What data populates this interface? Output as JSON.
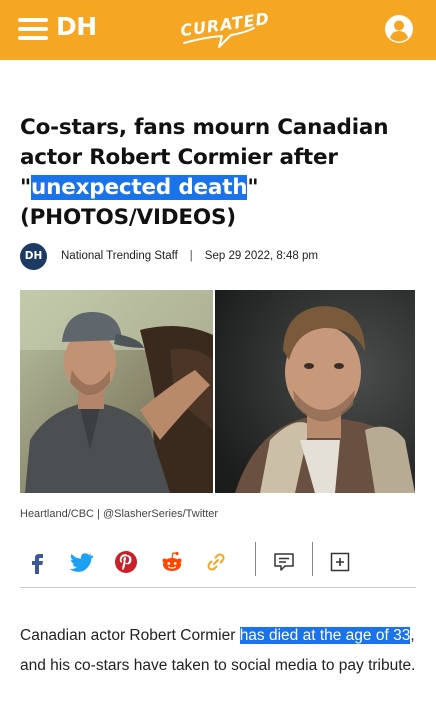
{
  "header": {
    "brand": "DH",
    "curated_logo": "CURATED",
    "menu_icon": "hamburger-menu-icon",
    "profile_icon": "user-profile-icon",
    "background_color": "#f5a623"
  },
  "article": {
    "headline_part1": "Co-stars, fans mourn Canadian actor Robert Cormier after \"",
    "headline_highlight": "unexpected death",
    "headline_part2": "\" (PHOTOS/VIDEOS)",
    "highlight_color": "#1a73e8",
    "author_badge": "DH",
    "author": "National Trending Staff",
    "separator": "|",
    "date": "Sep 29 2022, 8:48 pm",
    "photo_credit": "Heartland/CBC | @SlasherSeries/Twitter",
    "body_before": "Canadian actor Robert Cormier ",
    "body_highlight": "has died at the age of 33",
    "body_after": ", and his co-stars have taken to social media to pay tribute."
  },
  "share": {
    "icons": [
      "facebook-icon",
      "twitter-icon",
      "pinterest-icon",
      "reddit-icon",
      "link-icon",
      "comment-icon",
      "add-icon"
    ]
  }
}
